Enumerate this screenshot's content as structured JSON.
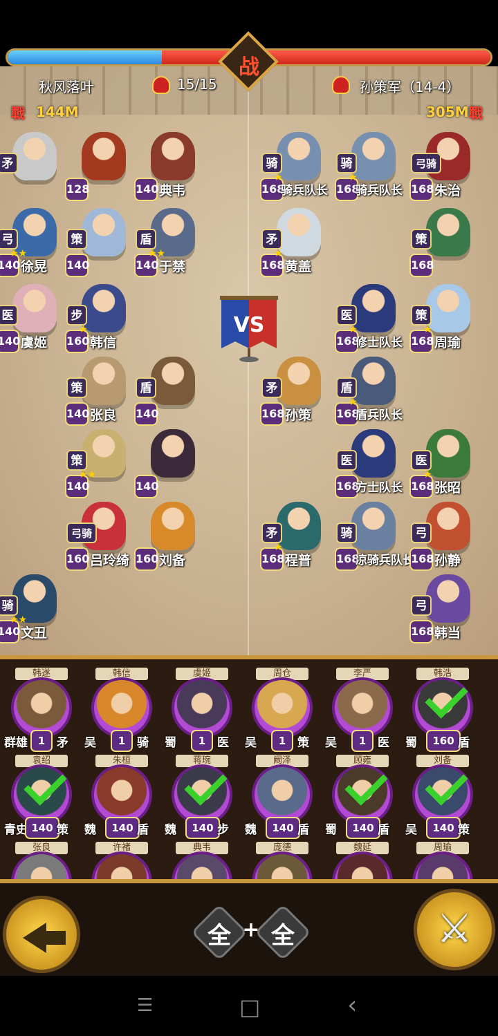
{
  "hud": {
    "war_glyph": "战",
    "left_player": "秋风落叶",
    "troop_count": "15/15",
    "right_player": "孙策军（14-4）",
    "left_power_glyph": "戰",
    "left_power": "144M",
    "right_power": "305M",
    "right_power_glyph": "戰",
    "left_power_share": 0.32
  },
  "vs_label": "VS",
  "left_units": [
    {
      "name": "",
      "type": "矛",
      "level": "",
      "stars": 0,
      "color": "#c9c9c9"
    },
    {
      "name": "",
      "type": "",
      "level": "128",
      "stars": 0,
      "color": "#a33a20"
    },
    {
      "name": "典韦",
      "type": "",
      "level": "140",
      "stars": 0,
      "color": "#8a3a2a"
    },
    {
      "name": "徐晃",
      "type": "弓",
      "level": "140",
      "stars": 2,
      "color": "#3a6aa8"
    },
    {
      "name": "",
      "type": "策",
      "level": "140",
      "stars": 0,
      "color": "#9fb8d8"
    },
    {
      "name": "于禁",
      "type": "盾",
      "level": "140",
      "stars": 2,
      "color": "#5a6a8a"
    },
    {
      "name": "虞姬",
      "type": "医",
      "level": "140",
      "stars": 0,
      "color": "#e0b0b8"
    },
    {
      "name": "韩信",
      "type": "步",
      "level": "160",
      "stars": 1,
      "color": "#3a4a8a"
    },
    {
      "name": "张良",
      "type": "策",
      "level": "140",
      "stars": 0,
      "color": "#b89a70"
    },
    {
      "name": "",
      "type": "盾",
      "level": "140",
      "stars": 0,
      "color": "#7a5a3a"
    },
    {
      "name": "",
      "type": "策",
      "level": "140",
      "stars": 2,
      "color": "#c8b070"
    },
    {
      "name": "",
      "type": "",
      "level": "140",
      "stars": 0,
      "color": "#3a2a3a"
    },
    {
      "name": "吕玲绮",
      "type": "弓骑",
      "level": "160",
      "stars": 0,
      "color": "#c8303a"
    },
    {
      "name": "刘备",
      "type": "",
      "level": "160",
      "stars": 0,
      "color": "#d88a2a"
    },
    {
      "name": "文丑",
      "type": "骑",
      "level": "140",
      "stars": 2,
      "color": "#2a4a6a"
    }
  ],
  "right_units": [
    {
      "name": "骑兵队长",
      "type": "骑",
      "level": "168",
      "stars": 1,
      "color": "#7890b0"
    },
    {
      "name": "骑兵队长",
      "type": "骑",
      "level": "168",
      "stars": 1,
      "color": "#7890b0"
    },
    {
      "name": "朱治",
      "type": "弓骑",
      "level": "168",
      "stars": 0,
      "color": "#9a2a2a"
    },
    {
      "name": "黄盖",
      "type": "矛",
      "level": "168",
      "stars": 1,
      "color": "#d0d8e0"
    },
    {
      "name": "",
      "type": "策",
      "level": "168",
      "stars": 0,
      "color": "#3a7a4a"
    },
    {
      "name": "修士队长",
      "type": "医",
      "level": "168",
      "stars": 1,
      "color": "#2a3a7a"
    },
    {
      "name": "周瑜",
      "type": "策",
      "level": "168",
      "stars": 1,
      "color": "#a8c8e8"
    },
    {
      "name": "孙策",
      "type": "矛",
      "level": "168",
      "stars": 0,
      "color": "#c89040"
    },
    {
      "name": "盾兵队长",
      "type": "盾",
      "level": "168",
      "stars": 1,
      "color": "#4a5a7a"
    },
    {
      "name": "方士队长",
      "type": "医",
      "level": "168",
      "stars": 0,
      "color": "#2a3a7a"
    },
    {
      "name": "张昭",
      "type": "医",
      "level": "168",
      "stars": 1,
      "color": "#3a7a3a"
    },
    {
      "name": "程普",
      "type": "矛",
      "level": "168",
      "stars": 1,
      "color": "#2a6a6a"
    },
    {
      "name": "凉骑兵队长",
      "type": "骑",
      "level": "168",
      "stars": 0,
      "color": "#6a80a0"
    },
    {
      "name": "孙静",
      "type": "弓",
      "level": "168",
      "stars": 0,
      "color": "#c05030"
    },
    {
      "name": "韩当",
      "type": "弓",
      "level": "168",
      "stars": 0,
      "color": "#6a4aa0"
    }
  ],
  "roster": [
    {
      "name": "韩遂",
      "faction": "群雄",
      "level": "1",
      "type": "矛",
      "checked": false,
      "color": "#7a5a3a"
    },
    {
      "name": "韩信",
      "faction": "吴",
      "level": "1",
      "type": "骑",
      "checked": false,
      "color": "#d8882a"
    },
    {
      "name": "虞姬",
      "faction": "蜀",
      "level": "1",
      "type": "医",
      "checked": false,
      "color": "#4a3a5a"
    },
    {
      "name": "周仓",
      "faction": "吴",
      "level": "1",
      "type": "策",
      "checked": false,
      "color": "#d8a850"
    },
    {
      "name": "李严",
      "faction": "吴",
      "level": "1",
      "type": "医",
      "checked": false,
      "color": "#8a6a4a"
    },
    {
      "name": "韩浩",
      "faction": "蜀",
      "level": "160",
      "type": "盾",
      "checked": true,
      "color": "#3a3a3a"
    },
    {
      "name": "袁绍",
      "faction": "青史",
      "level": "140",
      "type": "策",
      "checked": true,
      "color": "#2a4a4a"
    },
    {
      "name": "朱桓",
      "faction": "魏",
      "level": "140",
      "type": "盾",
      "checked": false,
      "color": "#8a3a2a"
    },
    {
      "name": "蒋琬",
      "faction": "魏",
      "level": "140",
      "type": "步",
      "checked": true,
      "color": "#3a3a4a"
    },
    {
      "name": "阚泽",
      "faction": "魏",
      "level": "140",
      "type": "盾",
      "checked": false,
      "color": "#5a6a8a"
    },
    {
      "name": "顾雍",
      "faction": "蜀",
      "level": "140",
      "type": "盾",
      "checked": true,
      "color": "#4a3a2a"
    },
    {
      "name": "刘备",
      "faction": "吴",
      "level": "140",
      "type": "策",
      "checked": true,
      "color": "#3a4a6a"
    },
    {
      "name": "张良",
      "faction": "",
      "level": "",
      "type": "",
      "checked": false,
      "color": "#7a7a7a"
    },
    {
      "name": "许褚",
      "faction": "",
      "level": "",
      "type": "",
      "checked": false,
      "color": "#7a3a2a"
    },
    {
      "name": "典韦",
      "faction": "",
      "level": "",
      "type": "",
      "checked": false,
      "color": "#5a4a6a"
    },
    {
      "name": "庞德",
      "faction": "",
      "level": "",
      "type": "",
      "checked": false,
      "color": "#6a5a3a"
    },
    {
      "name": "魏延",
      "faction": "",
      "level": "",
      "type": "",
      "checked": false,
      "color": "#5a2a2a"
    },
    {
      "name": "周瑜",
      "faction": "",
      "level": "",
      "type": "",
      "checked": false,
      "color": "#5a3a6a"
    }
  ],
  "controls": {
    "all_left": "全",
    "plus": "+",
    "all_right": "全"
  },
  "nav": {
    "menu_glyph": "☰",
    "home_glyph": "□",
    "back_glyph": "‹"
  },
  "colors": {
    "ally_bar": "#2a8ae0",
    "enemy_bar": "#d0281a",
    "frame_gold": "#c9973d"
  }
}
